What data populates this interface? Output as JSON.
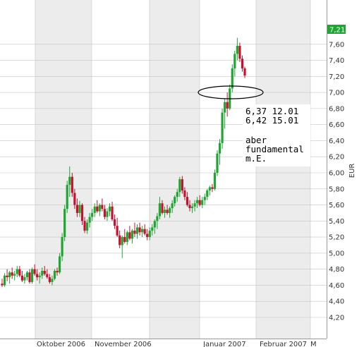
{
  "chart_data": {
    "type": "candlestick",
    "title": "",
    "xlabel": "",
    "ylabel": "EUR",
    "ylim": [
      4.0,
      7.7
    ],
    "yticks": [
      "4,20",
      "4,40",
      "4,60",
      "4,80",
      "5,00",
      "5,20",
      "5,40",
      "5,60",
      "5,80",
      "6,00",
      "6,20",
      "6,40",
      "6,60",
      "6,80",
      "7,00",
      "7,20",
      "7,40",
      "7,60"
    ],
    "ytick_values": [
      4.2,
      4.4,
      4.6,
      4.8,
      5.0,
      5.2,
      5.4,
      5.6,
      5.8,
      6.0,
      6.2,
      6.4,
      6.6,
      6.8,
      7.0,
      7.2,
      7.4,
      7.6
    ],
    "xticks": [
      "Oktober 2006",
      "November 2006",
      "Januar 2007",
      "Februar 2007",
      "M"
    ],
    "last_price": "7,21",
    "last_price_value": 7.21,
    "colors": {
      "up": "#1fa531",
      "down": "#c8102e",
      "last_price_bg": "#1fa531",
      "shade": "#ececec",
      "grid": "#c4c4c4"
    },
    "annotation": {
      "lines": [
        "6,37 12.01",
        "6,42 15.01",
        "",
        "aber",
        "fundamental",
        "m.E."
      ],
      "highlight": "ellipse around the 6,40 level"
    },
    "grid": true,
    "candles_ohlc": [
      [
        4.62,
        4.68,
        4.58,
        4.6
      ],
      [
        4.6,
        4.75,
        4.58,
        4.72
      ],
      [
        4.72,
        4.8,
        4.65,
        4.7
      ],
      [
        4.7,
        4.78,
        4.62,
        4.76
      ],
      [
        4.76,
        4.82,
        4.68,
        4.72
      ],
      [
        4.72,
        4.78,
        4.66,
        4.74
      ],
      [
        4.74,
        4.84,
        4.7,
        4.8
      ],
      [
        4.8,
        4.84,
        4.7,
        4.72
      ],
      [
        4.72,
        4.78,
        4.64,
        4.66
      ],
      [
        4.66,
        4.74,
        4.62,
        4.7
      ],
      [
        4.7,
        4.78,
        4.66,
        4.76
      ],
      [
        4.76,
        4.8,
        4.62,
        4.64
      ],
      [
        4.64,
        4.82,
        4.62,
        4.8
      ],
      [
        4.8,
        4.86,
        4.72,
        4.74
      ],
      [
        4.74,
        4.8,
        4.66,
        4.7
      ],
      [
        4.7,
        4.76,
        4.62,
        4.72
      ],
      [
        4.72,
        4.82,
        4.68,
        4.78
      ],
      [
        4.78,
        4.84,
        4.72,
        4.74
      ],
      [
        4.74,
        4.8,
        4.68,
        4.7
      ],
      [
        4.7,
        4.74,
        4.62,
        4.64
      ],
      [
        4.64,
        4.72,
        4.6,
        4.68
      ],
      [
        4.68,
        4.8,
        4.66,
        4.78
      ],
      [
        4.78,
        4.82,
        4.72,
        4.76
      ],
      [
        4.76,
        5.0,
        4.74,
        4.96
      ],
      [
        4.96,
        5.25,
        4.9,
        5.2
      ],
      [
        5.2,
        5.6,
        5.15,
        5.55
      ],
      [
        5.55,
        5.9,
        5.5,
        5.85
      ],
      [
        5.85,
        6.08,
        5.7,
        5.95
      ],
      [
        5.95,
        6.0,
        5.7,
        5.75
      ],
      [
        5.75,
        5.8,
        5.55,
        5.6
      ],
      [
        5.6,
        5.68,
        5.45,
        5.5
      ],
      [
        5.5,
        5.65,
        5.45,
        5.6
      ],
      [
        5.6,
        5.62,
        5.35,
        5.4
      ],
      [
        5.4,
        5.45,
        5.25,
        5.28
      ],
      [
        5.28,
        5.42,
        5.24,
        5.38
      ],
      [
        5.38,
        5.5,
        5.32,
        5.45
      ],
      [
        5.45,
        5.55,
        5.4,
        5.5
      ],
      [
        5.5,
        5.62,
        5.45,
        5.58
      ],
      [
        5.58,
        5.66,
        5.5,
        5.52
      ],
      [
        5.52,
        5.62,
        5.46,
        5.6
      ],
      [
        5.6,
        5.68,
        5.52,
        5.55
      ],
      [
        5.55,
        5.6,
        5.42,
        5.45
      ],
      [
        5.45,
        5.56,
        5.4,
        5.52
      ],
      [
        5.52,
        5.62,
        5.46,
        5.58
      ],
      [
        5.58,
        5.64,
        5.4,
        5.42
      ],
      [
        5.42,
        5.48,
        5.3,
        5.34
      ],
      [
        5.34,
        5.44,
        5.2,
        5.22
      ],
      [
        5.22,
        5.28,
        5.06,
        5.1
      ],
      [
        5.1,
        5.22,
        4.94,
        5.2
      ],
      [
        5.2,
        5.3,
        5.12,
        5.14
      ],
      [
        5.14,
        5.28,
        5.1,
        5.26
      ],
      [
        5.26,
        5.34,
        5.16,
        5.18
      ],
      [
        5.18,
        5.3,
        5.12,
        5.28
      ],
      [
        5.28,
        5.38,
        5.2,
        5.24
      ],
      [
        5.24,
        5.36,
        5.18,
        5.32
      ],
      [
        5.32,
        5.38,
        5.22,
        5.26
      ],
      [
        5.26,
        5.34,
        5.2,
        5.3
      ],
      [
        5.3,
        5.36,
        5.22,
        5.24
      ],
      [
        5.24,
        5.3,
        5.16,
        5.2
      ],
      [
        5.2,
        5.32,
        5.16,
        5.28
      ],
      [
        5.28,
        5.36,
        5.22,
        5.32
      ],
      [
        5.32,
        5.42,
        5.24,
        5.4
      ],
      [
        5.4,
        5.5,
        5.3,
        5.46
      ],
      [
        5.46,
        5.7,
        5.42,
        5.62
      ],
      [
        5.62,
        5.66,
        5.48,
        5.5
      ],
      [
        5.5,
        5.58,
        5.44,
        5.54
      ],
      [
        5.54,
        5.6,
        5.48,
        5.5
      ],
      [
        5.5,
        5.58,
        5.44,
        5.56
      ],
      [
        5.56,
        5.66,
        5.5,
        5.62
      ],
      [
        5.62,
        5.72,
        5.58,
        5.7
      ],
      [
        5.7,
        5.8,
        5.64,
        5.76
      ],
      [
        5.76,
        5.95,
        5.7,
        5.92
      ],
      [
        5.92,
        5.96,
        5.74,
        5.78
      ],
      [
        5.78,
        5.82,
        5.66,
        5.7
      ],
      [
        5.7,
        5.76,
        5.58,
        5.6
      ],
      [
        5.6,
        5.66,
        5.52,
        5.56
      ],
      [
        5.56,
        5.62,
        5.5,
        5.58
      ],
      [
        5.58,
        5.66,
        5.52,
        5.62
      ],
      [
        5.62,
        5.7,
        5.56,
        5.66
      ],
      [
        5.66,
        5.72,
        5.58,
        5.6
      ],
      [
        5.6,
        5.7,
        5.56,
        5.66
      ],
      [
        5.66,
        5.74,
        5.6,
        5.7
      ],
      [
        5.7,
        5.8,
        5.66,
        5.78
      ],
      [
        5.78,
        5.84,
        5.72,
        5.82
      ],
      [
        5.82,
        5.86,
        5.76,
        5.8
      ],
      [
        5.8,
        6.04,
        5.78,
        6.0
      ],
      [
        6.0,
        6.28,
        5.96,
        6.24
      ],
      [
        6.24,
        6.42,
        6.1,
        6.37
      ],
      [
        6.37,
        6.8,
        6.3,
        6.75
      ],
      [
        6.75,
        6.92,
        6.55,
        6.88
      ],
      [
        6.88,
        7.0,
        6.7,
        6.8
      ],
      [
        6.8,
        7.1,
        6.78,
        7.05
      ],
      [
        7.05,
        7.35,
        7.0,
        7.3
      ],
      [
        7.3,
        7.52,
        7.2,
        7.48
      ],
      [
        7.48,
        7.68,
        7.4,
        7.58
      ],
      [
        7.58,
        7.62,
        7.38,
        7.42
      ],
      [
        7.42,
        7.46,
        7.26,
        7.3
      ],
      [
        7.3,
        7.32,
        7.18,
        7.21
      ]
    ]
  }
}
